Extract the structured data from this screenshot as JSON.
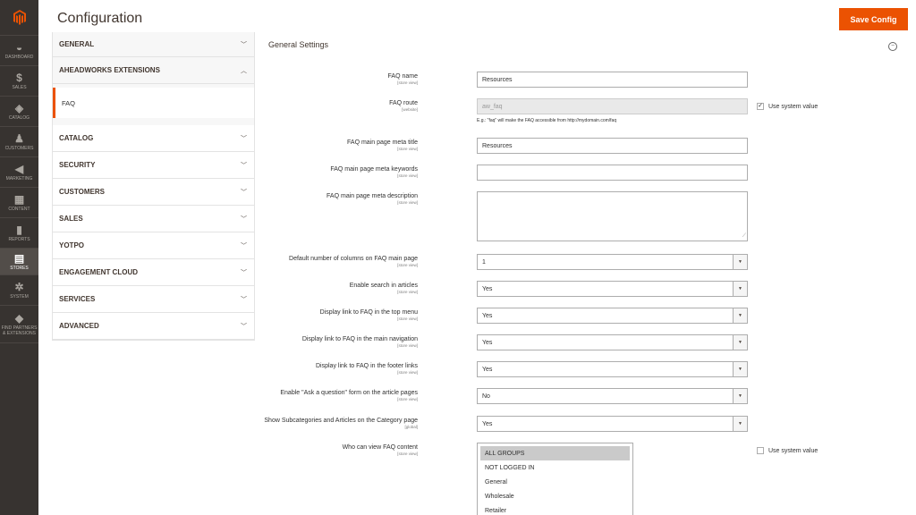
{
  "colors": {
    "accent": "#eb5202",
    "nav_bg": "#373330"
  },
  "nav": {
    "items": [
      {
        "label": "DASHBOARD",
        "icon": "dashboard-icon"
      },
      {
        "label": "SALES",
        "icon": "dollar-icon"
      },
      {
        "label": "CATALOG",
        "icon": "box-icon"
      },
      {
        "label": "CUSTOMERS",
        "icon": "person-icon"
      },
      {
        "label": "MARKETING",
        "icon": "megaphone-icon"
      },
      {
        "label": "CONTENT",
        "icon": "layout-icon"
      },
      {
        "label": "REPORTS",
        "icon": "bar-chart-icon"
      },
      {
        "label": "STORES",
        "icon": "store-icon"
      },
      {
        "label": "SYSTEM",
        "icon": "gear-icon"
      },
      {
        "label": "FIND PARTNERS & EXTENSIONS",
        "icon": "cube-icon"
      }
    ]
  },
  "header": {
    "title": "Configuration",
    "save_label": "Save Config"
  },
  "sidebar": {
    "general": "GENERAL",
    "aheadworks": "AHEADWORKS EXTENSIONS",
    "faq": "FAQ",
    "sections": [
      "CATALOG",
      "SECURITY",
      "CUSTOMERS",
      "SALES",
      "YOTPO",
      "ENGAGEMENT CLOUD",
      "SERVICES",
      "ADVANCED"
    ]
  },
  "form": {
    "title": "General Settings",
    "use_system_value": "Use system value",
    "faq_name": {
      "label": "FAQ name",
      "scope": "[store view]",
      "value": "Resources"
    },
    "faq_route": {
      "label": "FAQ route",
      "scope": "[website]",
      "value": "aw_faq",
      "note": "E.g.: \"faq\" will make the FAQ accessible from http://mydomain.com/faq"
    },
    "meta_title": {
      "label": "FAQ main page meta title",
      "scope": "[store view]",
      "value": "Resources"
    },
    "meta_keywords": {
      "label": "FAQ main page meta keywords",
      "scope": "[store view]",
      "value": ""
    },
    "meta_description": {
      "label": "FAQ main page meta description",
      "scope": "[store view]",
      "value": ""
    },
    "columns": {
      "label": "Default number of columns on FAQ main page",
      "scope": "[store view]",
      "value": "1"
    },
    "search": {
      "label": "Enable search in articles",
      "scope": "[store view]",
      "value": "Yes"
    },
    "top_menu": {
      "label": "Display link to FAQ in the top menu",
      "scope": "[store view]",
      "value": "Yes"
    },
    "main_nav": {
      "label": "Display link to FAQ in the main navigation",
      "scope": "[store view]",
      "value": "Yes"
    },
    "footer": {
      "label": "Display link to FAQ in the footer links",
      "scope": "[store view]",
      "value": "Yes"
    },
    "ask_question": {
      "label": "Enable \"Ask a question\" form on the article pages",
      "scope": "[store view]",
      "value": "No"
    },
    "subcategories": {
      "label": "Show Subcategories and Articles on the Category page",
      "scope": "[global]",
      "value": "Yes"
    },
    "who_can_view": {
      "label": "Who can view FAQ content",
      "scope": "[store view]",
      "options": [
        "ALL GROUPS",
        "NOT LOGGED IN",
        "General",
        "Wholesale",
        "Retailer"
      ]
    }
  }
}
